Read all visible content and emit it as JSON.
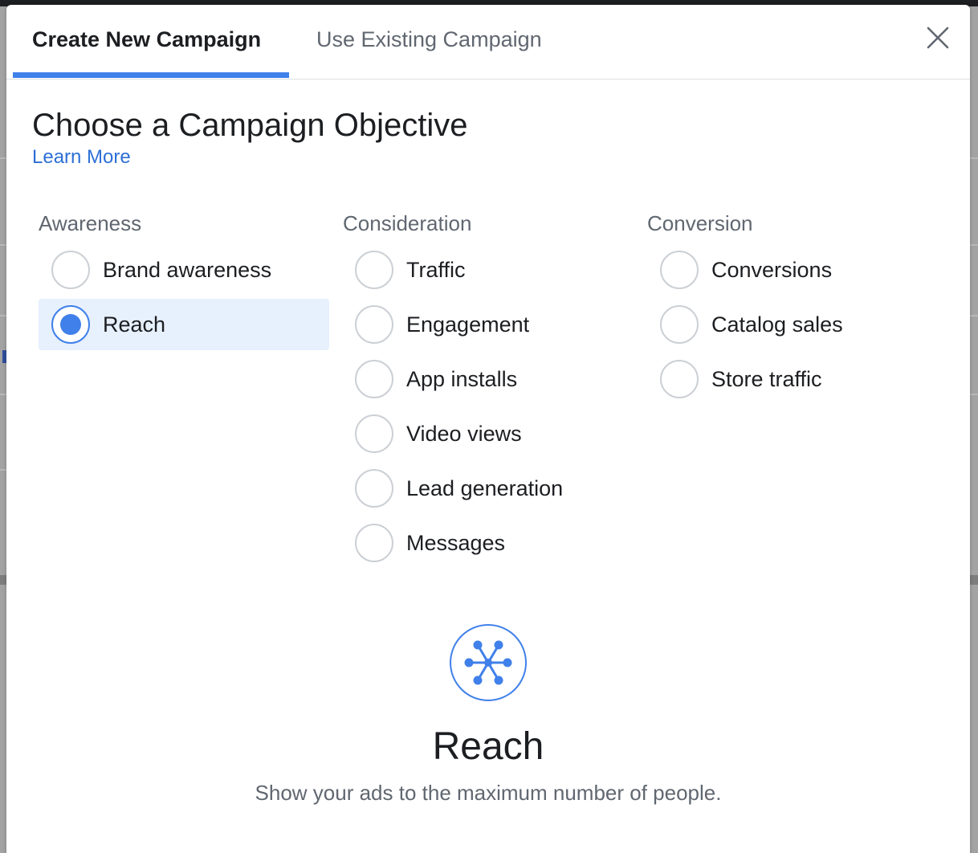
{
  "tabs": {
    "create": "Create New Campaign",
    "existing": "Use Existing Campaign"
  },
  "heading": "Choose a Campaign Objective",
  "learn_more": "Learn More",
  "columns": {
    "awareness": {
      "title": "Awareness",
      "options": [
        "Brand awareness",
        "Reach"
      ]
    },
    "consideration": {
      "title": "Consideration",
      "options": [
        "Traffic",
        "Engagement",
        "App installs",
        "Video views",
        "Lead generation",
        "Messages"
      ]
    },
    "conversion": {
      "title": "Conversion",
      "options": [
        "Conversions",
        "Catalog sales",
        "Store traffic"
      ]
    }
  },
  "selected_objective": "Reach",
  "detail": {
    "icon": "reach-icon",
    "title": "Reach",
    "description": "Show your ads to the maximum number of people."
  },
  "colors": {
    "accent": "#4080ea",
    "selected_bg": "#e7f0fd",
    "link": "#2d6fd6"
  }
}
